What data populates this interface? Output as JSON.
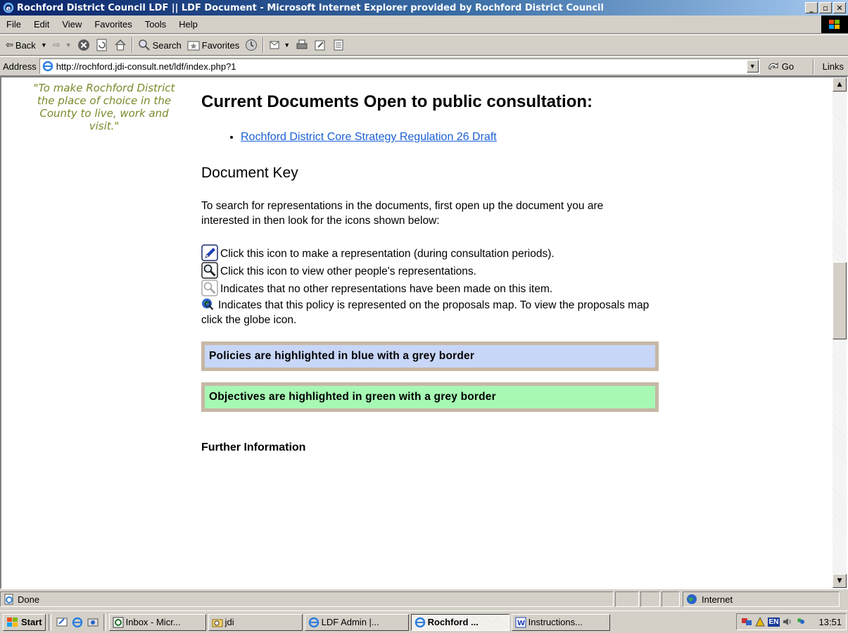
{
  "window": {
    "title": "Rochford District Council LDF || LDF Document - Microsoft Internet Explorer provided by Rochford District Council"
  },
  "menu": [
    "File",
    "Edit",
    "View",
    "Favorites",
    "Tools",
    "Help"
  ],
  "toolbar": {
    "back": "Back",
    "search": "Search",
    "favorites": "Favorites"
  },
  "address": {
    "label": "Address",
    "url": "http://rochford.jdi-consult.net/ldf/index.php?1",
    "go": "Go",
    "links": "Links"
  },
  "page": {
    "slogan": "\"To make Rochford District the place of choice in the County to live, work and visit.\"",
    "heading": "Current Documents Open to public consultation:",
    "documents": [
      "Rochford District Core Strategy Regulation 26 Draft"
    ],
    "key_heading": "Document Key",
    "intro": "To search for representations in the documents, first open up the document you are interested in then look for the icons shown below:",
    "key": [
      {
        "icon": "pencil-icon",
        "text": "Click this icon to make a representation (during consultation periods)."
      },
      {
        "icon": "magnifier-icon",
        "text": "Click this icon to view other people's representations."
      },
      {
        "icon": "magnifier-grey-icon",
        "text": "Indicates that no other representations have been made on this item."
      },
      {
        "icon": "globe-icon",
        "text": "Indicates that this policy is represented on the proposals map. To view the proposals map click the globe icon."
      }
    ],
    "policy_box": "Policies are highlighted in blue with a grey border",
    "objective_box": "Objectives are highlighted in green with a grey border",
    "further": "Further Information"
  },
  "status": {
    "text": "Done",
    "zone": "Internet"
  },
  "taskbar": {
    "start": "Start",
    "tasks": [
      {
        "label": "Inbox - Micr...",
        "active": false
      },
      {
        "label": "jdi",
        "active": false
      },
      {
        "label": "LDF Admin |...",
        "active": false
      },
      {
        "label": "Rochford ...",
        "active": true
      },
      {
        "label": "Instructions...",
        "active": false
      }
    ],
    "clock": "13:51",
    "lang": "EN"
  },
  "colors": {
    "policy_bg": "#c8d6f7",
    "objective_bg": "#a7f8b4",
    "box_border": "#c6b8a5",
    "link": "#1a5fd6",
    "slogan": "#7a8a2a"
  }
}
